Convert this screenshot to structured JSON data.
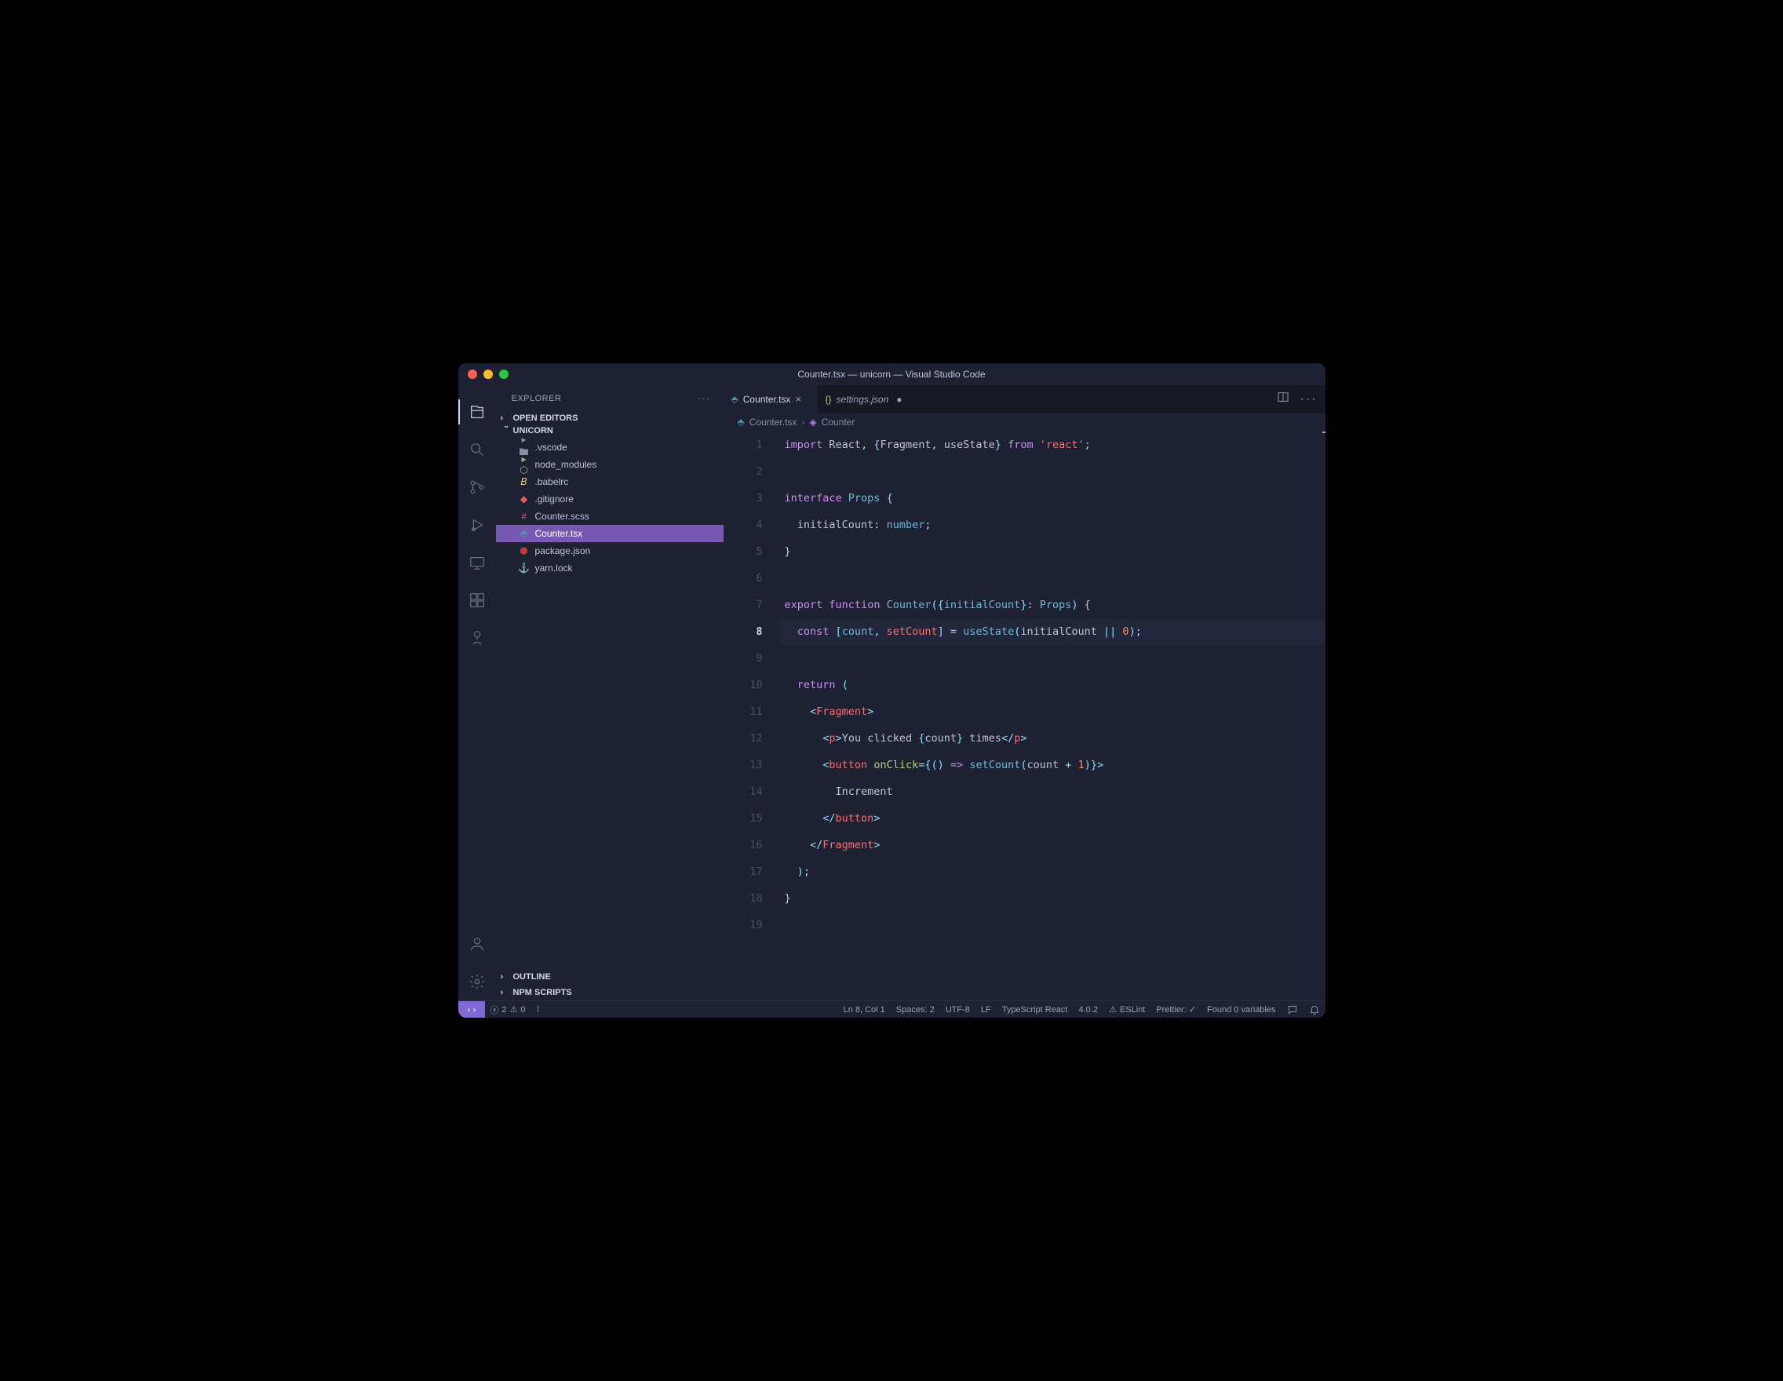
{
  "title": "Counter.tsx — unicorn — Visual Studio Code",
  "explorer": {
    "title": "EXPLORER",
    "sections": {
      "open_editors": "OPEN EDITORS",
      "project": "UNICORN",
      "outline": "OUTLINE",
      "npm": "NPM SCRIPTS"
    },
    "files": [
      {
        "name": ".vscode",
        "type": "folder",
        "icon": "folder"
      },
      {
        "name": "node_modules",
        "type": "folder",
        "icon": "package"
      },
      {
        "name": ".babelrc",
        "type": "file",
        "icon": "babel"
      },
      {
        "name": ".gitignore",
        "type": "file",
        "icon": "git"
      },
      {
        "name": "Counter.scss",
        "type": "file",
        "icon": "scss"
      },
      {
        "name": "Counter.tsx",
        "type": "file",
        "icon": "tsx",
        "selected": true
      },
      {
        "name": "package.json",
        "type": "file",
        "icon": "npm"
      },
      {
        "name": "yarn.lock",
        "type": "file",
        "icon": "yarn"
      }
    ]
  },
  "tabs": [
    {
      "label": "Counter.tsx",
      "active": true,
      "icon": "tsx"
    },
    {
      "label": "settings.json",
      "active": false,
      "icon": "json",
      "dirty": true,
      "italic": true
    }
  ],
  "breadcrumbs": {
    "file": "Counter.tsx",
    "symbol": "Counter"
  },
  "code": {
    "current_line": 8,
    "lines": [
      {
        "n": 1,
        "tokens": [
          [
            "kw",
            "import"
          ],
          [
            "txt",
            " React"
          ],
          [
            "pun",
            ", {"
          ],
          [
            "txt",
            "Fragment"
          ],
          [
            "pun",
            ", "
          ],
          [
            "txt",
            "useState"
          ],
          [
            "pun",
            "}"
          ],
          [
            "txt",
            " "
          ],
          [
            "kw",
            "from"
          ],
          [
            "txt",
            " "
          ],
          [
            "red",
            "'react'"
          ],
          [
            "pun",
            ";"
          ]
        ]
      },
      {
        "n": 2,
        "tokens": []
      },
      {
        "n": 3,
        "tokens": [
          [
            "kw",
            "interface"
          ],
          [
            "txt",
            " "
          ],
          [
            "ty",
            "Props"
          ],
          [
            "txt",
            " "
          ],
          [
            "pun",
            "{"
          ]
        ]
      },
      {
        "n": 4,
        "tokens": [
          [
            "txt",
            "  initialCount"
          ],
          [
            "pun",
            ":"
          ],
          [
            "txt",
            " "
          ],
          [
            "ty",
            "number"
          ],
          [
            "pun",
            ";"
          ]
        ]
      },
      {
        "n": 5,
        "tokens": [
          [
            "pun",
            "}"
          ]
        ]
      },
      {
        "n": 6,
        "tokens": []
      },
      {
        "n": 7,
        "tokens": [
          [
            "kw",
            "export"
          ],
          [
            "txt",
            " "
          ],
          [
            "kw",
            "function"
          ],
          [
            "txt",
            " "
          ],
          [
            "ty",
            "Counter"
          ],
          [
            "pun",
            "({"
          ],
          [
            "ty",
            "initialCount"
          ],
          [
            "pun",
            "}: "
          ],
          [
            "ty",
            "Props"
          ],
          [
            "pun",
            ") {"
          ]
        ]
      },
      {
        "n": 8,
        "tokens": [
          [
            "txt",
            "  "
          ],
          [
            "kw",
            "const"
          ],
          [
            "txt",
            " "
          ],
          [
            "pun",
            "["
          ],
          [
            "ty",
            "count"
          ],
          [
            "pun",
            ", "
          ],
          [
            "red",
            "setCount"
          ],
          [
            "pun",
            "] "
          ],
          [
            "pun",
            "="
          ],
          [
            "txt",
            " "
          ],
          [
            "ty",
            "useState"
          ],
          [
            "pun",
            "("
          ],
          [
            "txt",
            "initialCount "
          ],
          [
            "pun",
            "||"
          ],
          [
            "txt",
            " "
          ],
          [
            "num",
            "0"
          ],
          [
            "pun",
            ");"
          ]
        ]
      },
      {
        "n": 9,
        "tokens": []
      },
      {
        "n": 10,
        "tokens": [
          [
            "txt",
            "  "
          ],
          [
            "kw",
            "return"
          ],
          [
            "txt",
            " "
          ],
          [
            "pun",
            "("
          ]
        ]
      },
      {
        "n": 11,
        "tokens": [
          [
            "txt",
            "    "
          ],
          [
            "pun",
            "<"
          ],
          [
            "red",
            "Fragment"
          ],
          [
            "pun",
            ">"
          ]
        ]
      },
      {
        "n": 12,
        "tokens": [
          [
            "txt",
            "      "
          ],
          [
            "pun",
            "<"
          ],
          [
            "red",
            "p"
          ],
          [
            "pun",
            ">"
          ],
          [
            "txt",
            "You clicked "
          ],
          [
            "pun",
            "{"
          ],
          [
            "txt",
            "count"
          ],
          [
            "pun",
            "}"
          ],
          [
            "txt",
            " times"
          ],
          [
            "pun",
            "</"
          ],
          [
            "red",
            "p"
          ],
          [
            "pun",
            ">"
          ]
        ]
      },
      {
        "n": 13,
        "tokens": [
          [
            "txt",
            "      "
          ],
          [
            "pun",
            "<"
          ],
          [
            "red",
            "button"
          ],
          [
            "txt",
            " "
          ],
          [
            "prop",
            "onClick"
          ],
          [
            "pun",
            "="
          ],
          [
            "pun",
            "{"
          ],
          [
            "pun",
            "() "
          ],
          [
            "kw",
            "=>"
          ],
          [
            "txt",
            " "
          ],
          [
            "ty",
            "setCount"
          ],
          [
            "pun",
            "("
          ],
          [
            "txt",
            "count "
          ],
          [
            "pun",
            "+"
          ],
          [
            "txt",
            " "
          ],
          [
            "num",
            "1"
          ],
          [
            "pun",
            ")"
          ],
          [
            "pun",
            "}"
          ],
          [
            "pun",
            ">"
          ]
        ]
      },
      {
        "n": 14,
        "tokens": [
          [
            "txt",
            "        Increment"
          ]
        ]
      },
      {
        "n": 15,
        "tokens": [
          [
            "txt",
            "      "
          ],
          [
            "pun",
            "</"
          ],
          [
            "red",
            "button"
          ],
          [
            "pun",
            ">"
          ]
        ]
      },
      {
        "n": 16,
        "tokens": [
          [
            "txt",
            "    "
          ],
          [
            "pun",
            "</"
          ],
          [
            "red",
            "Fragment"
          ],
          [
            "pun",
            ">"
          ]
        ]
      },
      {
        "n": 17,
        "tokens": [
          [
            "txt",
            "  "
          ],
          [
            "pun",
            ");"
          ]
        ]
      },
      {
        "n": 18,
        "tokens": [
          [
            "pun",
            "}"
          ]
        ]
      },
      {
        "n": 19,
        "tokens": []
      }
    ]
  },
  "statusbar": {
    "errors": "2",
    "warnings": "0",
    "position": "Ln 8, Col 1",
    "spaces": "Spaces: 2",
    "encoding": "UTF-8",
    "eol": "LF",
    "language": "TypeScript React",
    "version": "4.0.2",
    "eslint": "ESLint",
    "prettier": "Prettier: ✓",
    "variables": "Found 0 variables"
  }
}
